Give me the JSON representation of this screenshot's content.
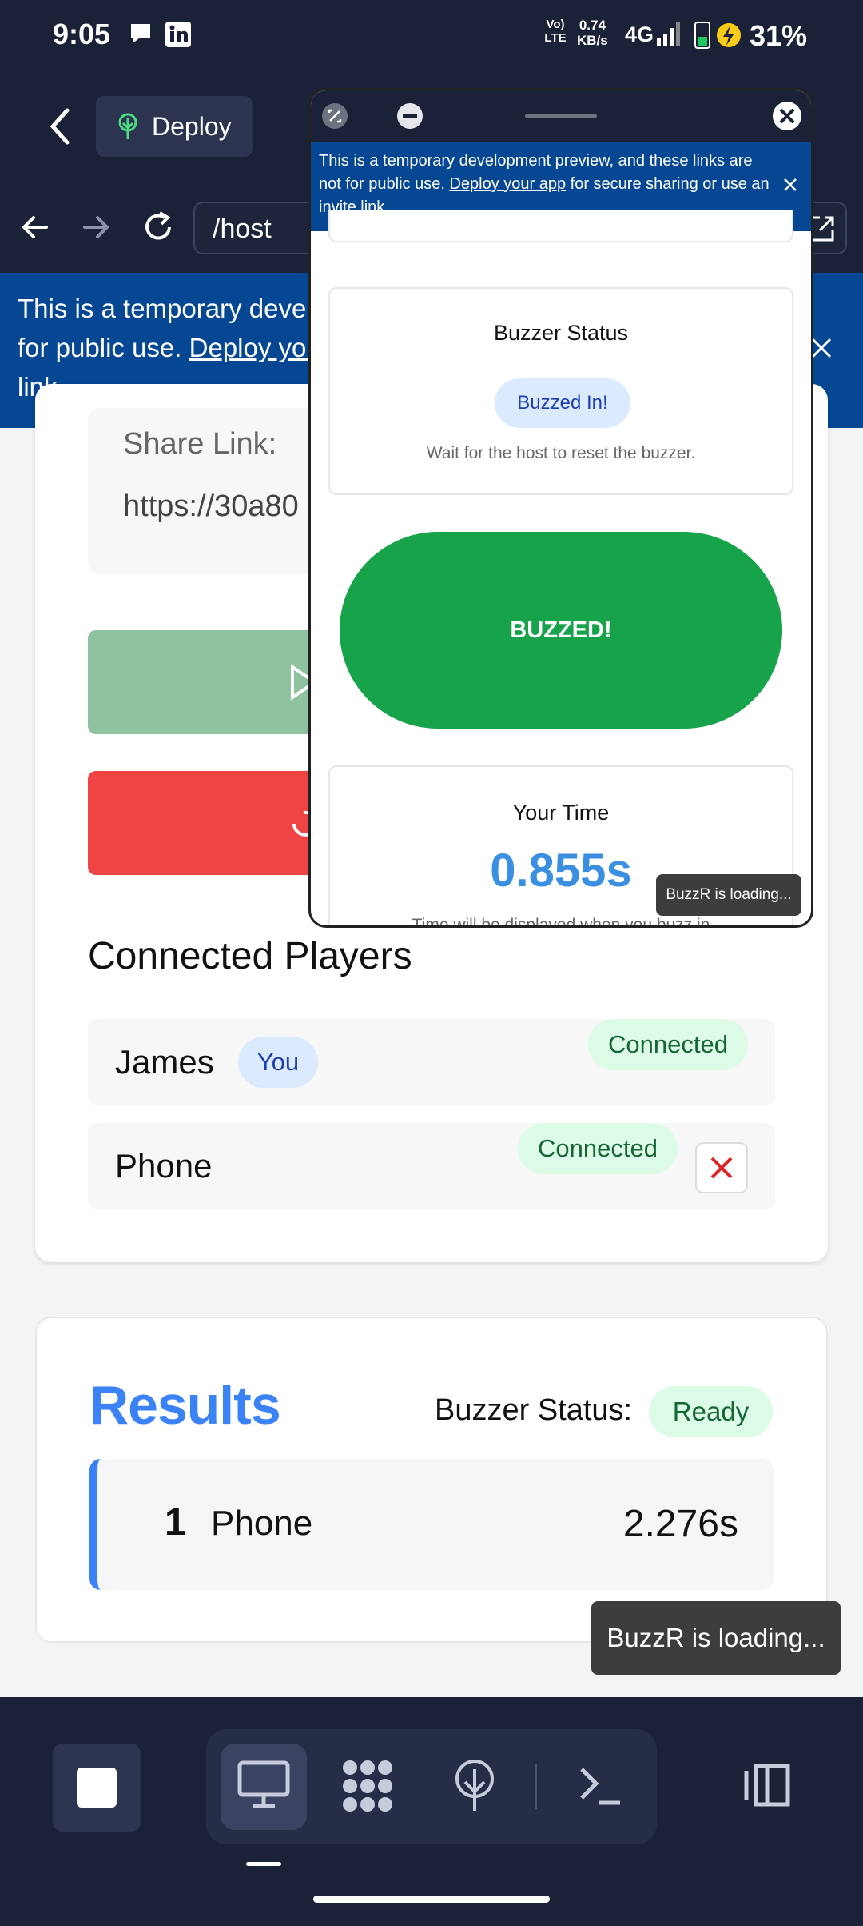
{
  "status_bar": {
    "time": "9:05",
    "net_type": "Vo) LTE",
    "speed_value": "0.74",
    "speed_unit": "KB/s",
    "network": "4G",
    "battery": "31%"
  },
  "app_bar": {
    "deploy_label": "Deploy"
  },
  "url_bar": {
    "path": "/host"
  },
  "banner": {
    "text_before": "This is a temporary development preview, and these links are not for public use. ",
    "link": "Deploy your app",
    "text_after": " for secure sharing or use an invite link."
  },
  "host": {
    "share_label": "Share Link:",
    "share_url": "https://30a80",
    "players_title": "Connected Players",
    "players": [
      {
        "name": "James",
        "you_badge": "You",
        "status": "Connected"
      },
      {
        "name": "Phone",
        "status": "Connected"
      }
    ]
  },
  "results": {
    "title": "Results",
    "buzzer_status_label": "Buzzer Status:",
    "buzzer_status": "Ready",
    "rows": [
      {
        "rank": "1",
        "name": "Phone",
        "time": "2.276s"
      }
    ]
  },
  "toast": "BuzzR is loading...",
  "preview": {
    "status_title": "Buzzer Status",
    "status_badge": "Buzzed In!",
    "status_note": "Wait for the host to reset the buzzer.",
    "buzz_button": "BUZZED!",
    "time_title": "Your Time",
    "time_value": "0.855s",
    "time_note": "Time will be displayed when you buzz in",
    "toast": "BuzzR is loading..."
  },
  "colors": {
    "chrome": "#1b2237",
    "banner": "#064793",
    "accent_blue": "#3b82f6",
    "buzz_green": "#16a34a",
    "danger_red": "#ef4444"
  }
}
